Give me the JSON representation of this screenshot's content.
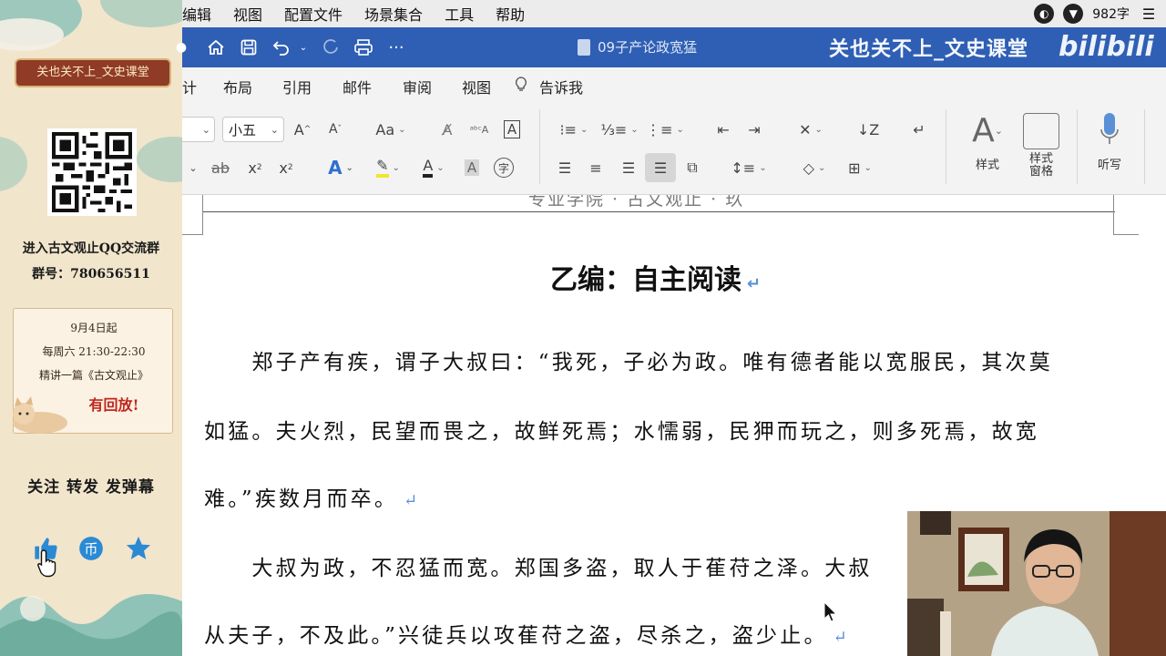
{
  "sidebar": {
    "banner": "关也关不上_文史课堂",
    "qq_group_line": "进入古文观止QQ交流群",
    "group_number": "群号：780656511",
    "notice": {
      "date": "9月4日起",
      "time": "每周六 21:30-22:30",
      "course": "精讲一篇《古文观止》",
      "replay": "有回放!"
    },
    "call_to_action": "关注  转发  发弹幕",
    "actions": [
      "like-icon",
      "coin-icon",
      "favorite-icon"
    ]
  },
  "menubar": {
    "items": [
      "编辑",
      "视图",
      "配置文件",
      "场景集合",
      "工具",
      "帮助"
    ],
    "word_count": "982字"
  },
  "titlebar": {
    "document_title": "09子产论政宽猛",
    "watermark": "关也关不上_文史课堂",
    "platform_logo": "bilibili"
  },
  "ribbon_tabs": [
    "计",
    "布局",
    "引用",
    "邮件",
    "审阅",
    "视图",
    "告诉我"
  ],
  "ribbon": {
    "font_size": "小五",
    "styles_label": "样式",
    "styles_pane_label": "样式\n窗格",
    "dictate_label": "听写"
  },
  "document": {
    "faint_header": "专业学院 · 古文观止 · 玖",
    "heading": "乙编：自主阅读",
    "lines": [
      "　　郑子产有疾，谓子大叔曰：“我死，子必为政。唯有德者能以宽服民，其次莫",
      "如猛。夫火烈，民望而畏之，故鲜死焉；水懦弱，民狎而玩之，则多死焉，故宽",
      "难。”疾数月而卒。",
      "　　大叔为政，不忍猛而宽。郑国多盗，取人于萑苻之泽。大叔",
      "从夫子，不及此。”兴徒兵以攻萑苻之盗，尽杀之，盗少止。"
    ],
    "paragraph_mark": "↵"
  },
  "colors": {
    "titlebar": "#2f5fb4",
    "banner": "#8f3b25",
    "paragraph_mark": "#5a8fd8"
  }
}
